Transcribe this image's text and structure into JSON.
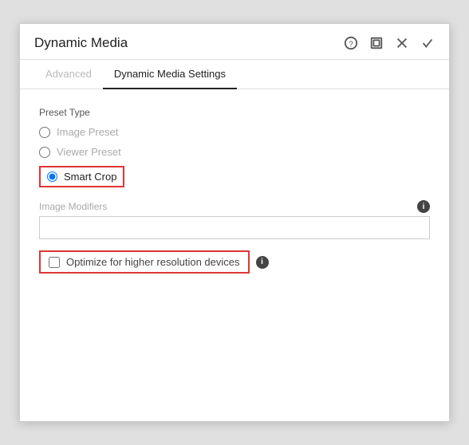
{
  "dialog": {
    "title": "Dynamic Media",
    "header_icons": {
      "help": "?",
      "expand": "⊡",
      "close": "✕",
      "check": "✓"
    }
  },
  "tabs": {
    "advanced_label": "Advanced",
    "settings_label": "Dynamic Media Settings"
  },
  "form": {
    "preset_type_label": "Preset Type",
    "image_preset_label": "Image Preset",
    "viewer_preset_label": "Viewer Preset",
    "smart_crop_label": "Smart Crop",
    "image_modifiers_label": "Image Modifiers",
    "image_modifiers_placeholder": "",
    "optimize_label": "Optimize for higher resolution devices",
    "info_icon_label": "i"
  }
}
